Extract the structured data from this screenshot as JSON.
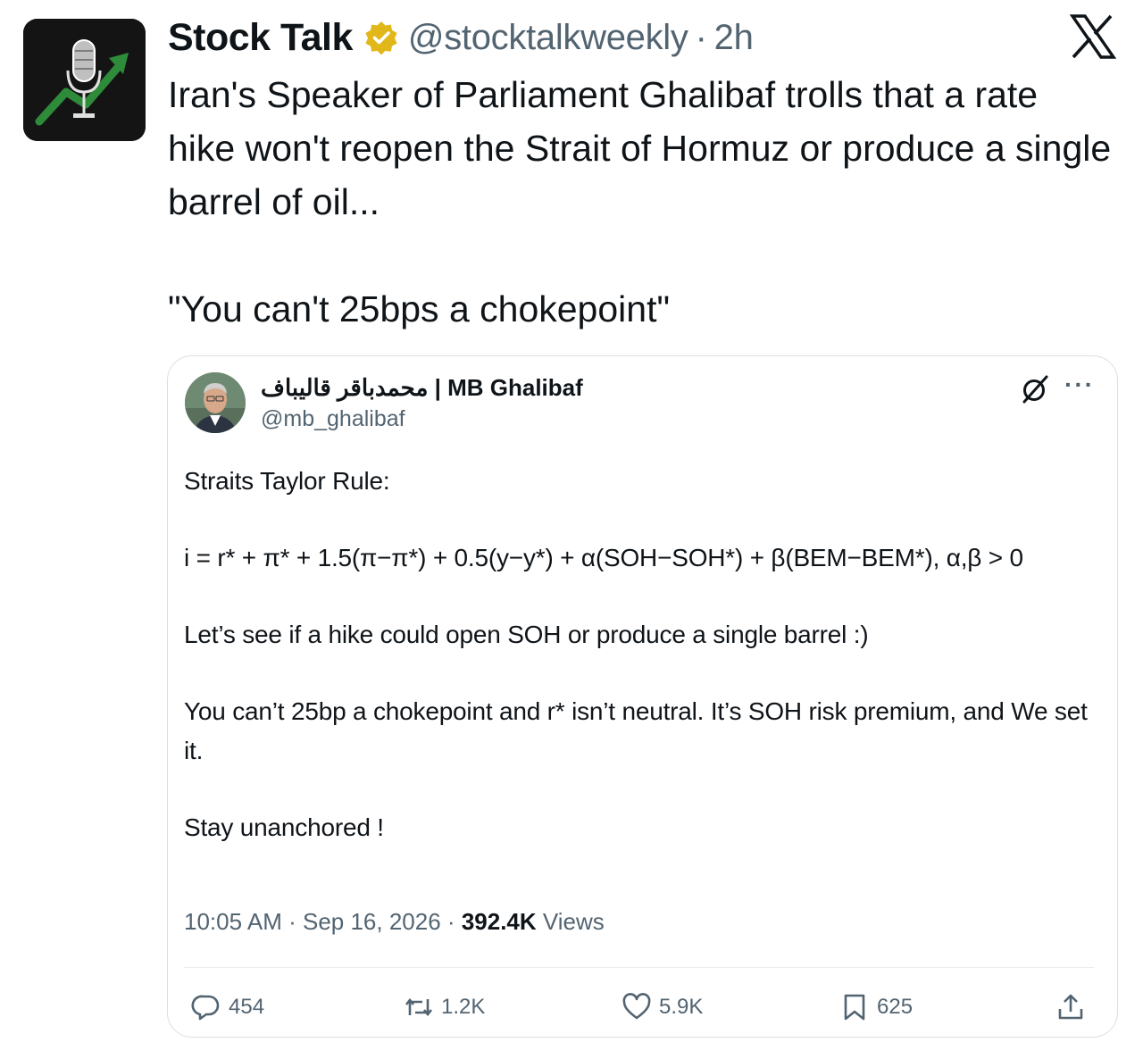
{
  "tweet": {
    "author_name": "Stock Talk",
    "handle": "@stocktalkweekly",
    "separator": "·",
    "time": "2h",
    "text_line1": "Iran's Speaker of Parliament Ghalibaf trolls that a rate hike won't reopen the Strait of Hormuz or produce a single barrel of oil...",
    "text_quote": "\"You can't 25bps a chokepoint\"",
    "icons": {
      "avatar": "microphone-chart-logo",
      "verified": "verified-badge-icon",
      "brand": "x-logo"
    },
    "colors": {
      "verified_gold": "#e2b719",
      "text": "#0f1419",
      "secondary": "#536471"
    }
  },
  "quoted": {
    "display_name": "محمدباقر قالیباف | MB Ghalibaf",
    "handle": "@mb_ghalibaf",
    "body": {
      "heading": "Straits Taylor Rule:",
      "formula": "i = r* + π* + 1.5(π−π*) + 0.5(y−y*) + α(SOH−SOH*) + β(BEM−BEM*), α,β > 0",
      "line2": "Let’s see if a hike could open SOH or produce a single barrel :)",
      "line3": "You can’t 25bp a chokepoint and r* isn’t neutral. It’s SOH risk premium, and We set it.",
      "line4": "Stay unanchored !"
    },
    "meta": {
      "time": "10:05 AM",
      "date": "Sep 16, 2026",
      "views_count": "392.4K",
      "views_label": "Views"
    },
    "actions": {
      "replies": "454",
      "reposts": "1.2K",
      "likes": "5.9K",
      "bookmarks": "625"
    },
    "icons": [
      "grok-icon",
      "more-icon",
      "reply-icon",
      "repost-icon",
      "like-icon",
      "bookmark-icon",
      "share-icon"
    ]
  }
}
